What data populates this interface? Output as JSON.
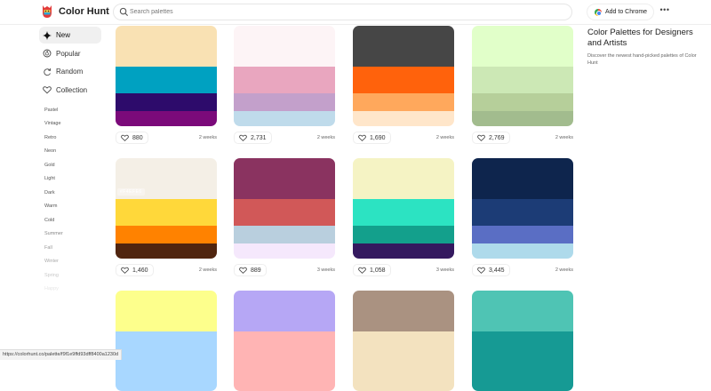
{
  "header": {
    "brand": "Color Hunt",
    "search_placeholder": "Search palettes",
    "chrome_button": "Add to Chrome",
    "more": "•••"
  },
  "sidebar": {
    "nav": [
      {
        "label": "New",
        "icon": "sparkle-icon",
        "active": true
      },
      {
        "label": "Popular",
        "icon": "popular-icon",
        "active": false
      },
      {
        "label": "Random",
        "icon": "random-icon",
        "active": false
      },
      {
        "label": "Collection",
        "icon": "heart-icon",
        "active": false
      }
    ],
    "tags": [
      "Pastel",
      "Vintage",
      "Retro",
      "Neon",
      "Gold",
      "Light",
      "Dark",
      "Warm",
      "Cold",
      "Summer",
      "Fall",
      "Winter",
      "Spring",
      "Happy"
    ]
  },
  "palettes": [
    {
      "likes": "880",
      "date": "2 weeks",
      "colors": [
        "#F9E1B3",
        "#00A1C1",
        "#2D0B6B",
        "#7B0A7A"
      ]
    },
    {
      "likes": "2,731",
      "date": "2 weeks",
      "colors": [
        "#FDF4F6",
        "#E9A6BF",
        "#C3A0CB",
        "#BFDBEB"
      ]
    },
    {
      "likes": "1,690",
      "date": "2 weeks",
      "colors": [
        "#464646",
        "#FF620C",
        "#FFA85C",
        "#FFE6CA"
      ]
    },
    {
      "likes": "2,769",
      "date": "2 weeks",
      "colors": [
        "#E1FFC9",
        "#CCE8B5",
        "#B6CF9A",
        "#A2BC8E"
      ]
    },
    {
      "likes": "1,460",
      "date": "2 weeks",
      "colors": [
        "#F4EFE6",
        "#FFD83A",
        "#FF8200",
        "#50250F"
      ],
      "copy_label": "#F4EFE6"
    },
    {
      "likes": "889",
      "date": "3 weeks",
      "colors": [
        "#8A3360",
        "#D15858",
        "#B9CFDE",
        "#F5E8FC"
      ]
    },
    {
      "likes": "1,058",
      "date": "3 weeks",
      "colors": [
        "#F5F3C4",
        "#2CE3C2",
        "#13A08C",
        "#34195F"
      ]
    },
    {
      "likes": "3,445",
      "date": "2 weeks",
      "colors": [
        "#0E254D",
        "#1C3C76",
        "#5A6EC4",
        "#AEDAEB"
      ]
    },
    {
      "likes": "",
      "date": "",
      "colors": [
        "#FDFF8C",
        "#A8D7FF"
      ]
    },
    {
      "likes": "",
      "date": "",
      "colors": [
        "#B6A7F5",
        "#FFB4B4"
      ]
    },
    {
      "likes": "",
      "date": "",
      "colors": [
        "#AA9281",
        "#F3E2BF"
      ]
    },
    {
      "likes": "",
      "date": "",
      "colors": [
        "#4FC4B4",
        "#169A94"
      ]
    }
  ],
  "promo": {
    "title": "Color Palettes for Designers and Artists",
    "text": "Discover the newest hand-picked palettes of Color Hunt"
  },
  "status_url": "https://colorhunt.co/palette/f9f1e9ffd93dff8400a1230d"
}
